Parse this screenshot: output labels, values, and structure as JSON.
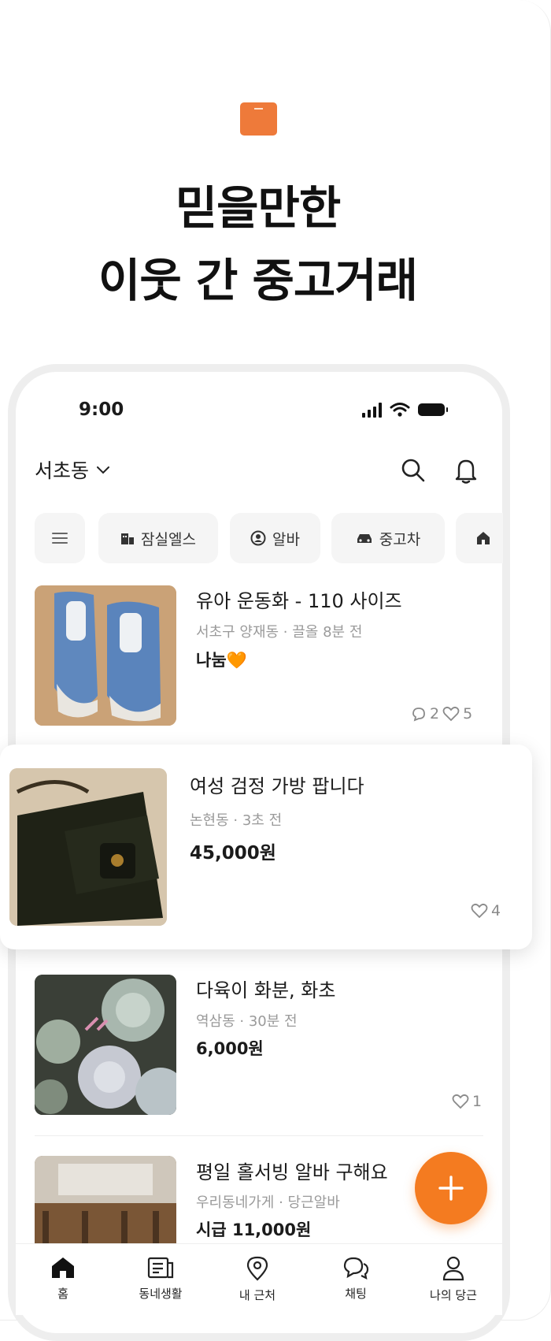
{
  "promo": {
    "headline_line1": "믿을만한",
    "headline_line2": "이웃 간 중고거래"
  },
  "status_bar": {
    "time": "9:00"
  },
  "header": {
    "location": "서초동"
  },
  "chips": [
    {
      "icon": "building-icon",
      "label": "잠실엘스"
    },
    {
      "icon": "person-badge-icon",
      "label": "알바"
    },
    {
      "icon": "car-icon",
      "label": "중고차"
    },
    {
      "icon": "house-icon",
      "label": ""
    }
  ],
  "listings": [
    {
      "title": "유아 운동화 - 110 사이즈",
      "meta": "서초구 양재동 · 끌올 8분 전",
      "price": "나눔🧡",
      "comments": "2",
      "likes": "5"
    },
    {
      "title": "여성 검정 가방 팝니다",
      "meta": "논현동 · 3초 전",
      "price": "45,000원",
      "likes": "4"
    },
    {
      "title": "다육이 화분, 화초",
      "meta": "역삼동 · 30분 전",
      "price": "6,000원",
      "likes": "1"
    },
    {
      "title": "평일 홀서빙 알바 구해요",
      "meta": "우리동네가게 · 당근알바",
      "price": "시급 11,000원"
    }
  ],
  "tabbar": [
    {
      "icon": "home-icon",
      "label": "홈"
    },
    {
      "icon": "newspaper-icon",
      "label": "동네생활"
    },
    {
      "icon": "location-pin-icon",
      "label": "내 근처"
    },
    {
      "icon": "chat-icon",
      "label": "채팅"
    },
    {
      "icon": "user-icon",
      "label": "나의 당근"
    }
  ],
  "colors": {
    "accent": "#f47b20",
    "brand_icon": "#ee7a3a"
  }
}
